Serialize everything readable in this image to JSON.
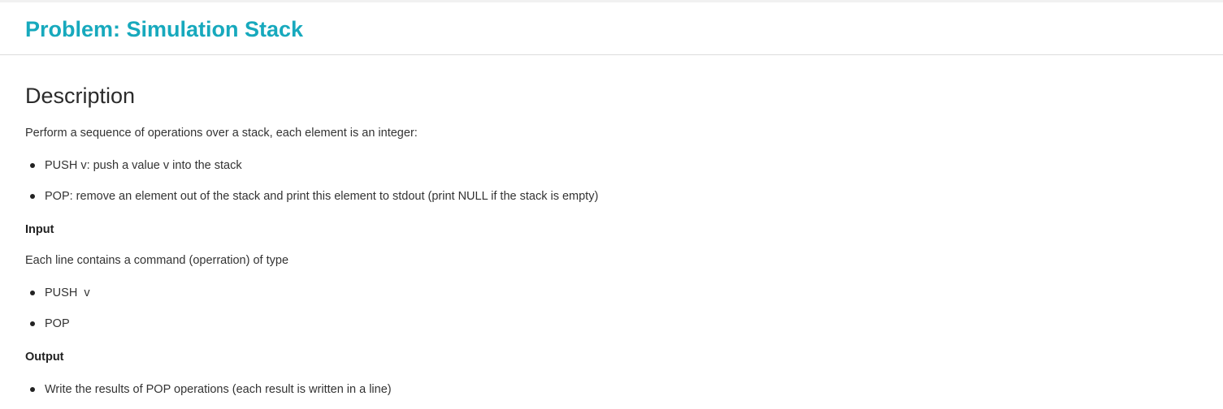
{
  "page": {
    "title": "Problem: Simulation Stack"
  },
  "description": {
    "heading": "Description",
    "intro": "Perform a sequence of operations over a stack, each element is an integer:",
    "operations": [
      "PUSH v: push a value v into the stack",
      "POP: remove an element out of the stack and print this element to stdout (print NULL if the stack is empty)"
    ]
  },
  "input": {
    "label": "Input",
    "text": "Each line contains a command (operration) of type",
    "commands": [
      "PUSH  v",
      "POP"
    ]
  },
  "output": {
    "label": "Output",
    "items": [
      "Write the results of POP operations (each result is written in a line)"
    ]
  },
  "colors": {
    "title": "#17a9bd",
    "text": "#333333"
  }
}
